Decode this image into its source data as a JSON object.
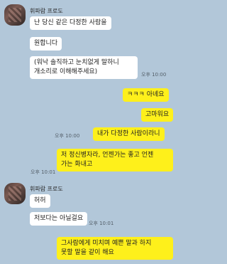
{
  "messages": [
    {
      "sender": "휘파람 프로도",
      "text": "난 당신 같은 다정한 사람을",
      "side": "in"
    },
    {
      "text": "원합니다",
      "side": "in"
    },
    {
      "text": "(워낙 솔직하고 눈치없게 말하니\n개소리로 이해해주세요)",
      "side": "in",
      "time": "오후 10:00"
    },
    {
      "text": "ㅋㅋㅋ 아녜요",
      "side": "out"
    },
    {
      "text": "고마워요",
      "side": "out"
    },
    {
      "text": "내가 다정한 사람이라니",
      "side": "out",
      "time": "오후 10:00"
    },
    {
      "text": "저 정신병자라, 언젠가는 좋고 언젠\n가는 화내고",
      "side": "out",
      "time": "오후 10:01"
    },
    {
      "sender": "휘파람 프로도",
      "text": "허허",
      "side": "in"
    },
    {
      "text": "저보다는 아닐걸요",
      "side": "in",
      "time": "오후 10:01"
    },
    {
      "text": "그사람에게 미치며 예쁜 말과 하지\n못할 말을 같이 해요",
      "side": "out"
    }
  ]
}
